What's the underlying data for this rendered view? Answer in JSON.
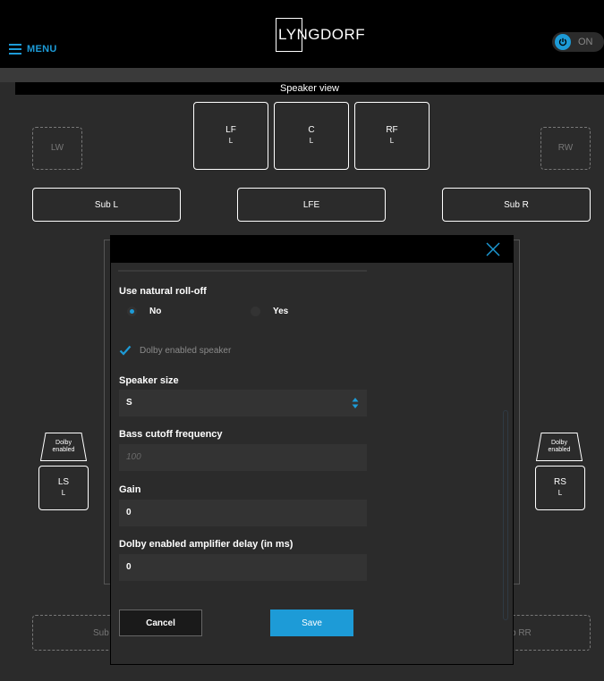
{
  "header": {
    "menu_label": "MENU",
    "logo_text": "LYNGDORF",
    "power_label": "ON"
  },
  "speaker_view": {
    "title": "Speaker view",
    "front": [
      {
        "name": "LF",
        "sub": "L"
      },
      {
        "name": "C",
        "sub": "L"
      },
      {
        "name": "RF",
        "sub": "L"
      }
    ],
    "lw": "LW",
    "rw": "RW",
    "subs": [
      "Sub L",
      "LFE",
      "Sub R"
    ],
    "dolby_badge": "Dolby enabled",
    "ls": {
      "name": "LS",
      "sub": "L"
    },
    "rs": {
      "name": "RS",
      "sub": "L"
    },
    "bottom_left_partial": "Sub",
    "bottom_right_partial": "b RR"
  },
  "dialog": {
    "roll_off_label": "Use natural roll-off",
    "roll_off_options": [
      "No",
      "Yes"
    ],
    "roll_off_selected": "No",
    "dolby_checkbox_label": "Dolby enabled speaker",
    "dolby_checked": true,
    "speaker_size_label": "Speaker size",
    "speaker_size_value": "S",
    "bass_cutoff_label": "Bass cutoff frequency",
    "bass_cutoff_placeholder": "100",
    "gain_label": "Gain",
    "gain_value": "0",
    "delay_label": "Dolby enabled amplifier delay (in ms)",
    "delay_value": "0",
    "cancel_label": "Cancel",
    "save_label": "Save"
  },
  "colors": {
    "accent": "#1d9bd7",
    "background": "#2b2b2b",
    "header": "#000000",
    "field": "#333333"
  }
}
